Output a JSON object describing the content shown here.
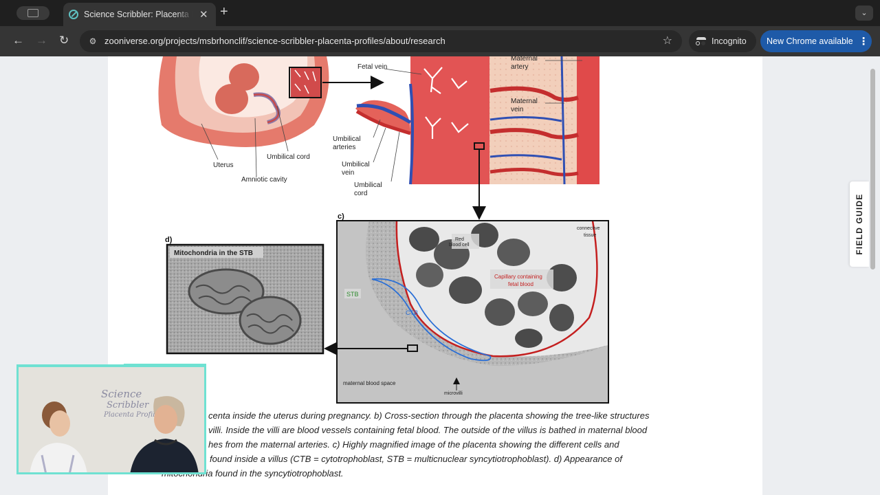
{
  "browser": {
    "tab_title": "Science Scribbler: Placenta P",
    "url": "zooniverse.org/projects/msbrhonclif/science-scribbler-placenta-profiles/about/research",
    "incognito_label": "Incognito",
    "update_label": "New Chrome available"
  },
  "figure": {
    "a_labels": {
      "uterus": "Uterus",
      "umbilical_cord": "Umbilical cord",
      "amniotic_cavity": "Amniotic cavity"
    },
    "b_labels": {
      "fetal_vein": "Fetal vein",
      "maternal_artery_1": "Maternal",
      "maternal_artery_2": "artery",
      "maternal_vein_1": "Maternal",
      "maternal_vein_2": "vein",
      "umbilical_arteries_1": "Umbilical",
      "umbilical_arteries_2": "arteries",
      "umbilical_vein_1": "Umbilical",
      "umbilical_vein_2": "vein",
      "umbilical_cord_1": "Umbilical",
      "umbilical_cord_2": "cord"
    },
    "c_labels": {
      "panel": "c)",
      "red_blood_cell_1": "Red",
      "red_blood_cell_2": "blood cell",
      "connective_1": "connective",
      "connective_2": "tissue",
      "capillary_1": "Capillary containing",
      "capillary_2": "fetal blood",
      "stb": "STB",
      "ctb": "CTB",
      "maternal_blood_space": "maternal blood space",
      "microvilli": "microvilli"
    },
    "d_labels": {
      "panel": "d)",
      "title": "Mitochondria in the STB"
    }
  },
  "caption": {
    "line1": "centa inside the uterus during pregnancy. b) Cross-section through the placenta showing the tree-like structures",
    "line2": "villi. Inside the villi are blood vessels containing fetal blood. The outside of the villus is bathed in maternal blood",
    "line3": "hes from the maternal arteries. c) Highly magnified image of the placenta showing the different cells and",
    "line4": "found inside a villus (CTB = cytotrophoblast, STB = multicnuclear syncytiotrophoblast). d) Appearance of",
    "line5": "mitochondria found in the syncytiotrophoblast."
  },
  "field_guide": "FIELD GUIDE",
  "webcam": {
    "board_line1": "Science",
    "board_line2": "Scribbler",
    "board_line3": "Placenta Profiles"
  }
}
